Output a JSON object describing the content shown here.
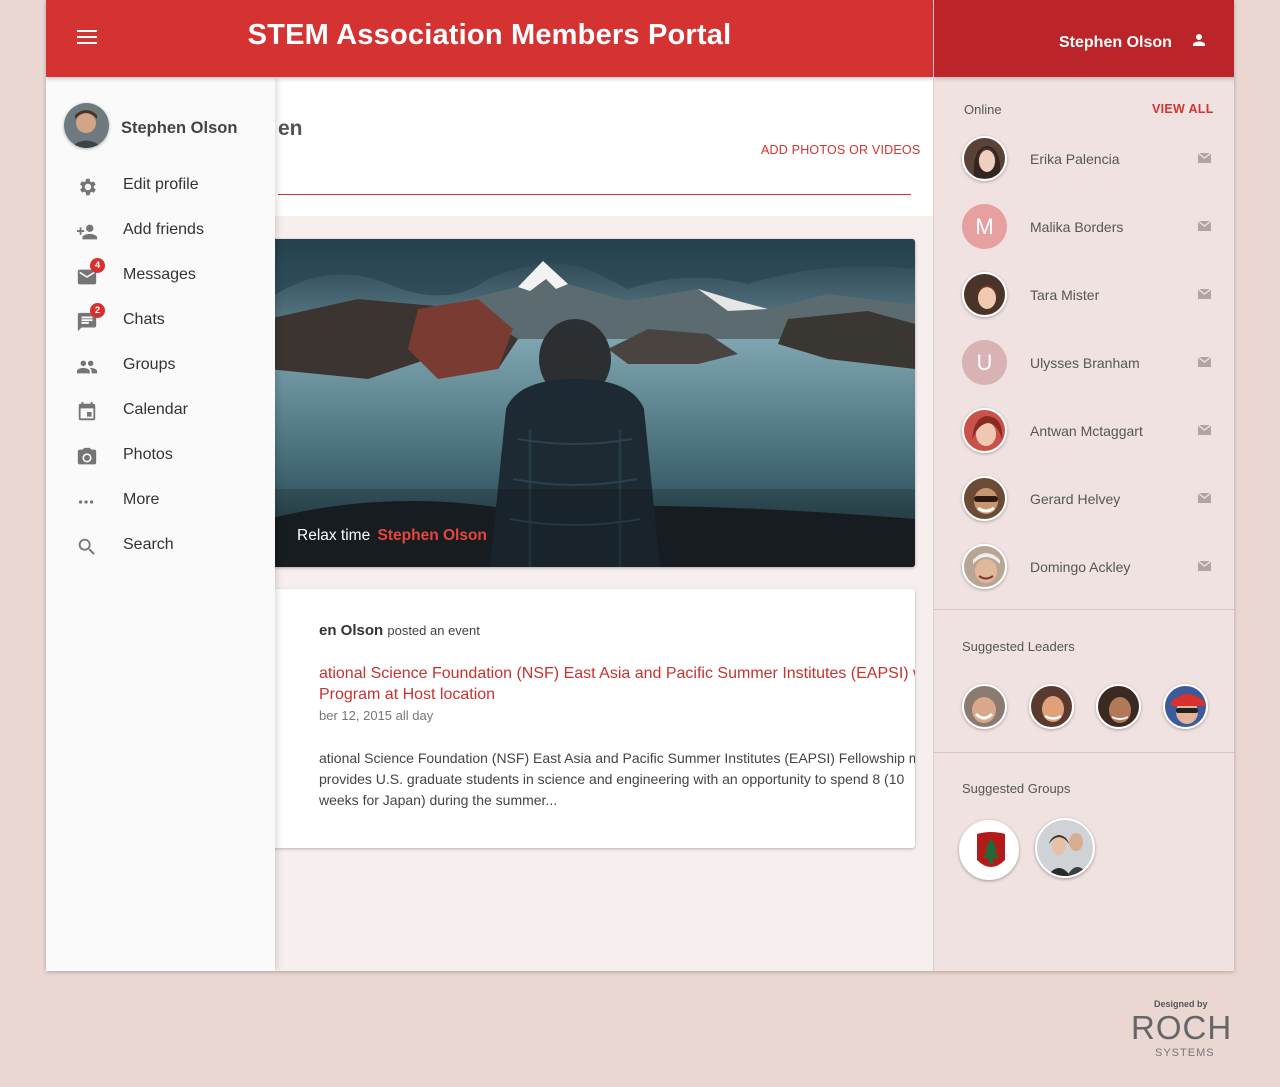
{
  "app": {
    "title": "STEM Association Members Portal"
  },
  "user": {
    "name": "Stephen Olson"
  },
  "drawer": {
    "items": [
      {
        "label": "Edit profile",
        "icon": "gear-icon"
      },
      {
        "label": "Add friends",
        "icon": "add-person-icon"
      },
      {
        "label": "Messages",
        "icon": "mail-icon",
        "badge": "4"
      },
      {
        "label": "Chats",
        "icon": "chat-icon",
        "badge": "2"
      },
      {
        "label": "Groups",
        "icon": "people-icon"
      },
      {
        "label": "Calendar",
        "icon": "calendar-icon"
      },
      {
        "label": "Photos",
        "icon": "camera-icon"
      },
      {
        "label": "More",
        "icon": "more-dots-icon"
      },
      {
        "label": "Search",
        "icon": "search-icon"
      }
    ]
  },
  "composer": {
    "name_fragment": "en",
    "add_media": "ADD PHOTOS OR VIDEOS"
  },
  "photo_post": {
    "caption": "Relax time",
    "author": "Stephen Olson"
  },
  "event_post": {
    "poster": "en Olson",
    "action": "posted an event",
    "title": "ational Science Foundation (NSF) East Asia and Pacific Summer Institutes (EAPSI) wship Program at Host location",
    "date": "ber 12, 2015 all day",
    "description": "ational Science Foundation (NSF) East Asia and Pacific Summer Institutes (EAPSI) Fellowship m provides U.S. graduate students in science and engineering with an opportunity to spend 8 (10 weeks for Japan) during the summer..."
  },
  "online": {
    "title": "Online",
    "view_all": "VIEW ALL",
    "contacts": [
      {
        "name": "Erika Palencia",
        "avatar": "photo",
        "color": "#7a5a4f"
      },
      {
        "name": "Malika Borders",
        "avatar": "M",
        "color": "#e6a0a0"
      },
      {
        "name": "Tara Mister",
        "avatar": "photo",
        "color": "#8c5a3e"
      },
      {
        "name": "Ulysses Branham",
        "avatar": "U",
        "color": "#d9b3b3"
      },
      {
        "name": "Antwan Mctaggart",
        "avatar": "photo",
        "color": "#c9534a"
      },
      {
        "name": "Gerard Helvey",
        "avatar": "photo",
        "color": "#6b4a36"
      },
      {
        "name": "Domingo Ackley",
        "avatar": "photo",
        "color": "#a88a78"
      }
    ]
  },
  "suggested_leaders": {
    "title": "Suggested Leaders"
  },
  "suggested_groups": {
    "title": "Suggested Groups"
  },
  "credit": {
    "small": "Designed by",
    "logo": "ROCH",
    "sub": "SYSTEMS"
  },
  "colors": {
    "primary": "#d43331",
    "primary_dark": "#bb2428",
    "background": "#ead7d2"
  }
}
